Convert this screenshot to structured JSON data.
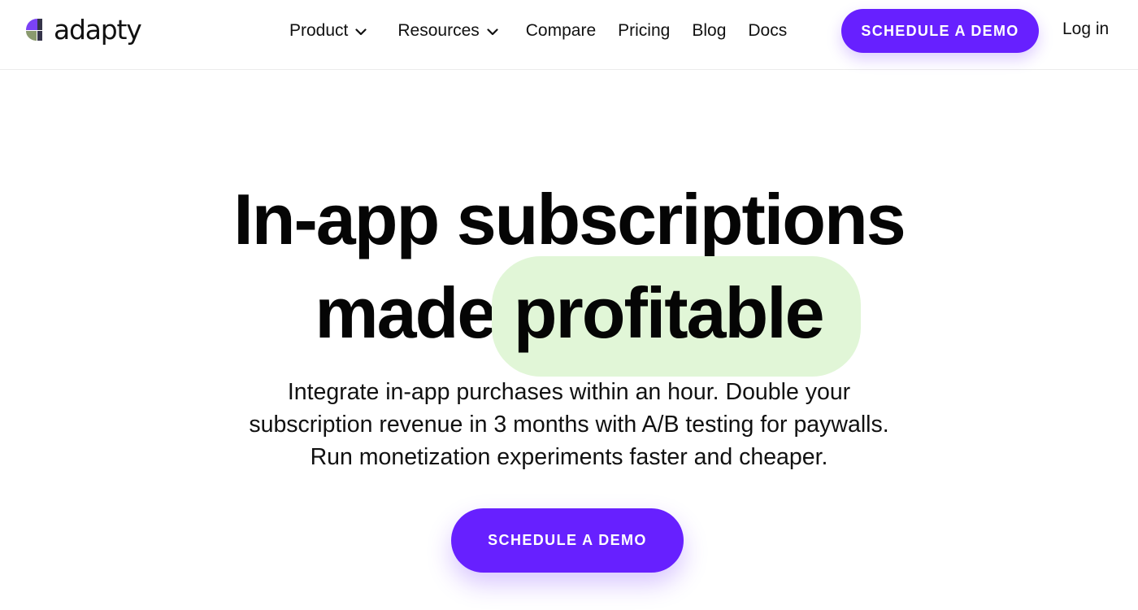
{
  "brand": {
    "name": "adapty",
    "colors": {
      "accent": "#6720ff",
      "highlight": "#e1f6d7",
      "logo_purple": "#7b42f6",
      "logo_dark": "#35344a",
      "logo_olive": "#8a9a6e"
    }
  },
  "nav": {
    "items": [
      {
        "label": "Product",
        "icon": "chevron-down-icon"
      },
      {
        "label": "Resources",
        "icon": "chevron-down-icon"
      },
      {
        "label": "Compare"
      },
      {
        "label": "Pricing"
      },
      {
        "label": "Blog"
      },
      {
        "label": "Docs"
      }
    ],
    "cta_label": "SCHEDULE A DEMO",
    "login_label": "Log in"
  },
  "hero": {
    "title_line1": "In-app subscriptions",
    "title_line2_prefix": "made",
    "title_line2_highlight": "profitable",
    "subtitle_lines": [
      "Integrate in-app purchases within an hour. Double your",
      "subscription revenue in 3 months with A/B testing for paywalls.",
      "Run monetization experiments faster and cheaper."
    ],
    "cta_label": "SCHEDULE A DEMO"
  }
}
